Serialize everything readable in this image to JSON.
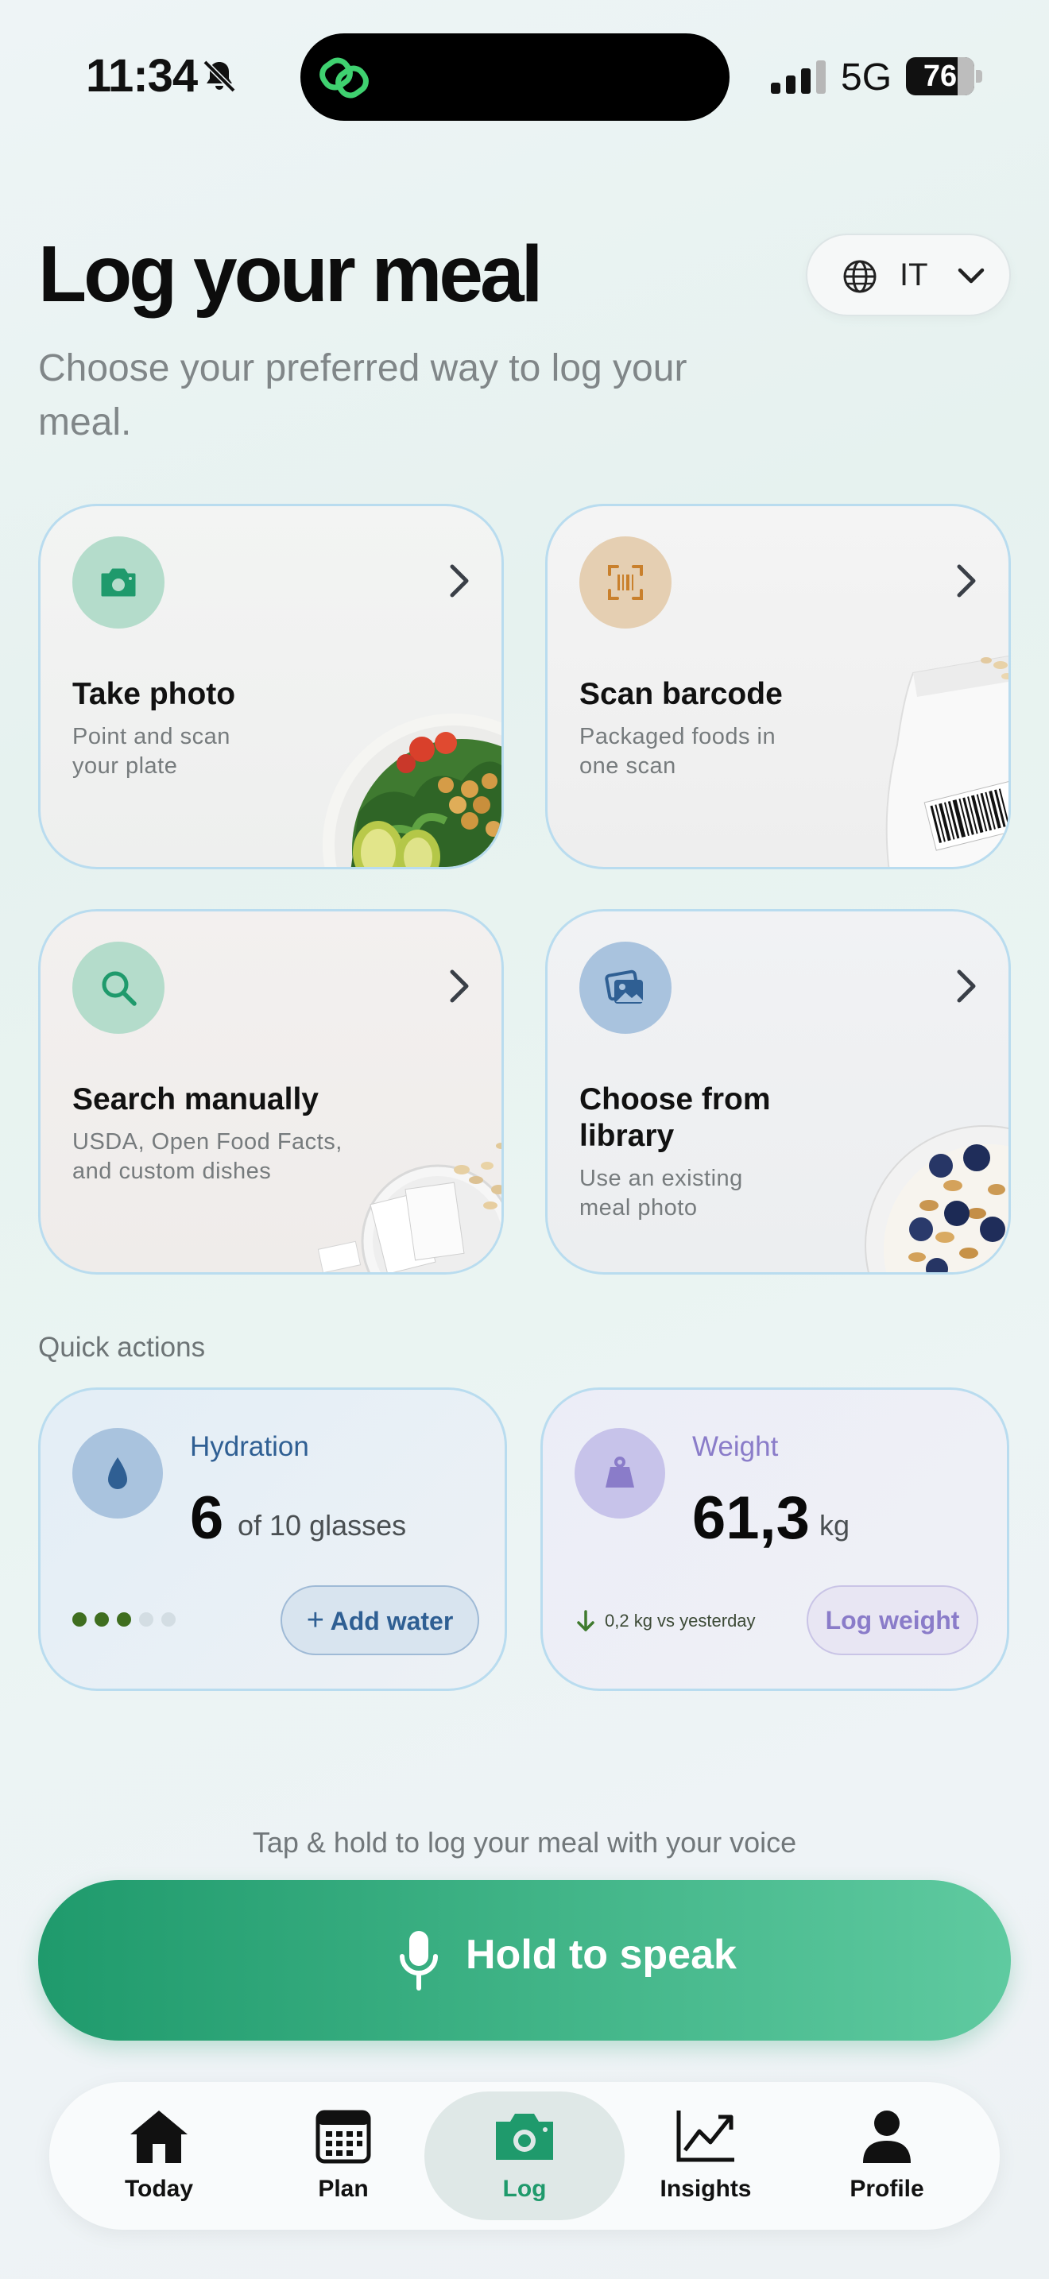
{
  "status_bar": {
    "time": "11:34",
    "network": "5G",
    "battery": "76",
    "battery_level": 0.76
  },
  "header": {
    "title": "Log your meal",
    "subtitle": "Choose your preferred way to log your meal.",
    "language": "IT"
  },
  "methods": [
    {
      "title": "Take photo",
      "desc": "Point and scan your plate",
      "icon": "camera-icon"
    },
    {
      "title": "Scan barcode",
      "desc": "Packaged foods in one scan",
      "icon": "barcode-icon"
    },
    {
      "title": "Search manually",
      "desc": "USDA, Open Food Facts, and custom dishes",
      "icon": "search-icon"
    },
    {
      "title": "Choose from library",
      "desc": "Use an existing meal photo",
      "icon": "photos-icon"
    }
  ],
  "quick_actions": {
    "label": "Quick actions",
    "hydration": {
      "title": "Hydration",
      "value": "6",
      "unit": "of 10 glasses",
      "button": "Add water",
      "progress": 0.6
    },
    "weight": {
      "title": "Weight",
      "value": "61,3",
      "unit": "kg",
      "change": "0,2 kg vs yesterday",
      "button": "Log weight"
    }
  },
  "voice": {
    "hint": "Tap & hold to log your meal with your voice",
    "button": "Hold to speak"
  },
  "tabs": [
    {
      "label": "Today",
      "icon": "home-icon"
    },
    {
      "label": "Plan",
      "icon": "calendar-icon"
    },
    {
      "label": "Log",
      "icon": "camera-icon",
      "active": true
    },
    {
      "label": "Insights",
      "icon": "chart-icon"
    },
    {
      "label": "Profile",
      "icon": "person-icon"
    }
  ],
  "colors": {
    "accent": "#1f9a6c",
    "hydration": "#2f5f93",
    "weight": "#8a7cc9",
    "card_border": "#b9dcef"
  }
}
